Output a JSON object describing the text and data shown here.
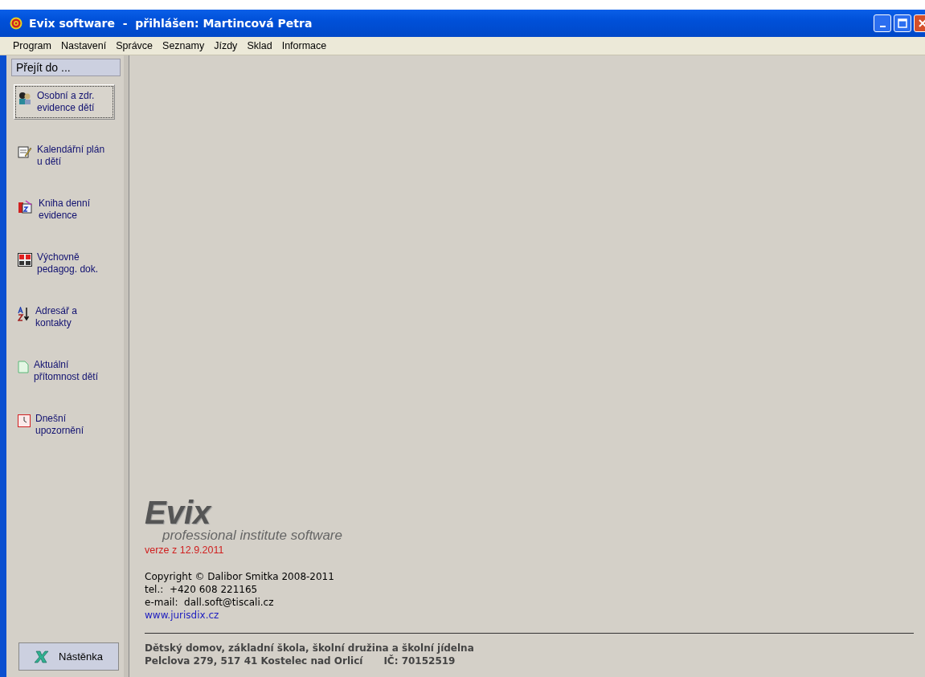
{
  "window": {
    "title": "Evix software  -  přihlášen: Martincová Petra"
  },
  "menu": [
    "Program",
    "Nastavení",
    "Správce",
    "Seznamy",
    "Jízdy",
    "Sklad",
    "Informace"
  ],
  "sidebar": {
    "header": "Přejít do ...",
    "items": [
      {
        "label": "Osobní a zdr.\nevidence dětí",
        "selected": true
      },
      {
        "label": "Kalendářní plán\nu dětí",
        "selected": false
      },
      {
        "label": "Kniha denní\nevidence",
        "selected": false
      },
      {
        "label": "Výchovně\npedagog. dok.",
        "selected": false
      },
      {
        "label": "Adresář a\nkontakty",
        "selected": false
      },
      {
        "label": "Aktuální\npřítomnost dětí",
        "selected": false
      },
      {
        "label": "Dnešní\nupozornění",
        "selected": false
      }
    ],
    "button": "Nástěnka"
  },
  "about": {
    "logo": "Evix",
    "tagline": "professional institute software",
    "version": "verze z 12.9.2011",
    "lines": [
      "Copyright © Dalibor Smitka 2008-2011",
      "tel.:  +420 608 221165",
      "e-mail:  dall.soft@tiscali.cz"
    ],
    "link": "www.jurisdix.cz",
    "org": "Dětský domov, základní škola, školní družina a školní jídelna",
    "address": "Pelclova 279, 517 41 Kostelec nad Orlicí",
    "ic": "IČ: 70152519"
  }
}
